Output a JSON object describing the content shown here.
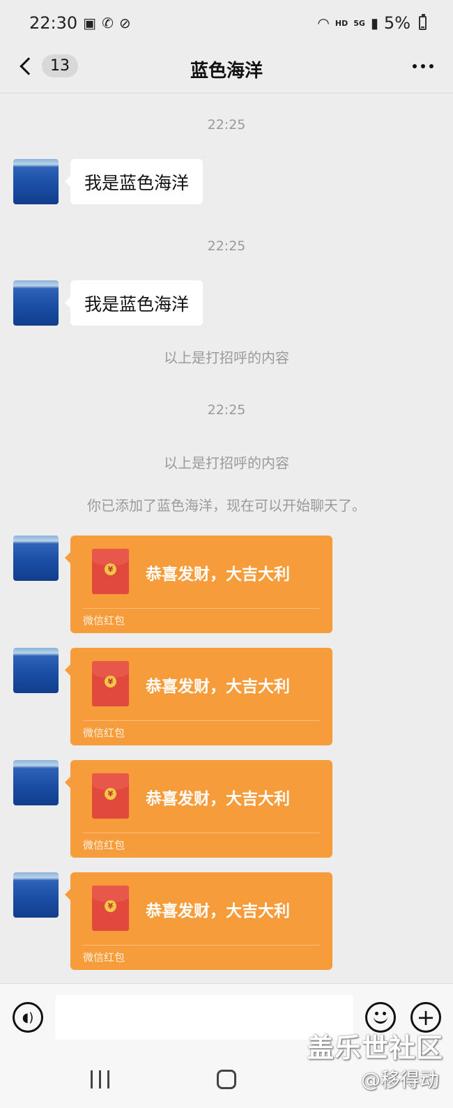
{
  "status_bar": {
    "time": "22:30",
    "battery": "5%",
    "network": "5G",
    "hd": "HD",
    "icons": [
      "image-icon",
      "call-icon",
      "location-off-icon",
      "wifi-icon",
      "signal-icon",
      "battery-icon"
    ]
  },
  "header": {
    "back_label": "<",
    "unread_count": "13",
    "title": "蓝色海洋",
    "more_icon": "more-icon"
  },
  "messages": {
    "time_1": "22:25",
    "msg_1": "我是蓝色海洋",
    "time_2": "22:25",
    "msg_2": "我是蓝色海洋",
    "system_1": "以上是打招呼的内容",
    "time_3": "22:25",
    "system_2": "以上是打招呼的内容",
    "system_3": "你已添加了蓝色海洋，现在可以开始聊天了。",
    "red_packets": [
      {
        "title": "恭喜发财，大吉大利",
        "footer": "微信红包",
        "symbol": "¥"
      },
      {
        "title": "恭喜发财，大吉大利",
        "footer": "微信红包",
        "symbol": "¥"
      },
      {
        "title": "恭喜发财，大吉大利",
        "footer": "微信红包",
        "symbol": "¥"
      },
      {
        "title": "恭喜发财，大吉大利",
        "footer": "微信红包",
        "symbol": "¥"
      }
    ]
  },
  "input_bar": {
    "text_value": "",
    "plus_label": "+"
  },
  "watermark": {
    "line_1": "盖乐世社区",
    "line_2": "@移得动"
  },
  "colors": {
    "background": "#ededed",
    "red_packet": "#f79c3a",
    "envelope": "#e2493d",
    "bubble": "#ffffff"
  }
}
